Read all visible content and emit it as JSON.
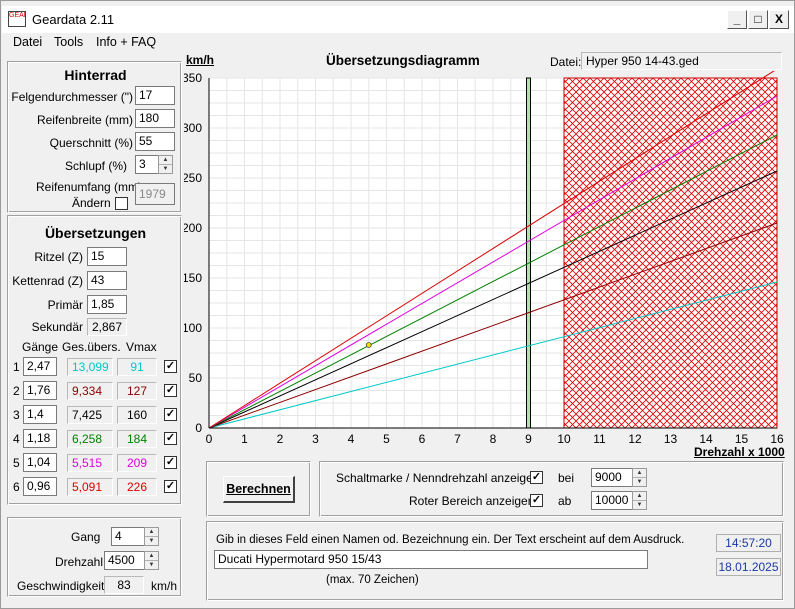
{
  "window": {
    "title": "Geardata 2.11",
    "icon_text": "GEAR",
    "buttons": {
      "minimize": "_",
      "maximize": "□",
      "close": "X"
    }
  },
  "menu": [
    "Datei",
    "Tools",
    "Info + FAQ"
  ],
  "hinterrad": {
    "title": "Hinterrad",
    "felgen_label": "Felgendurchmesser (\")",
    "felgen_value": "17",
    "breite_label": "Reifenbreite (mm)",
    "breite_value": "180",
    "querschnitt_label": "Querschnitt (%)",
    "querschnitt_value": "55",
    "schlupf_label": "Schlupf (%)",
    "schlupf_value": "3",
    "umfang_label": "Reifenumfang (mm)",
    "aendern_label": "Ändern",
    "umfang_value": "1979"
  },
  "uebersetzungen": {
    "title": "Übersetzungen",
    "ritzel_label": "Ritzel (Z)",
    "ritzel_value": "15",
    "kettenrad_label": "Kettenrad (Z)",
    "kettenrad_value": "43",
    "primaer_label": "Primär",
    "primaer_value": "1,85",
    "sekundaer_label": "Sekundär",
    "sekundaer_value": "2,867",
    "col_gaenge": "Gänge",
    "col_ges": "Ges.übers.",
    "col_vmax": "Vmax",
    "gears": [
      {
        "num": "1",
        "ratio": "2,47",
        "total": "13,099",
        "vmax": "91",
        "color": "#00c8c8"
      },
      {
        "num": "2",
        "ratio": "1,76",
        "total": "9,334",
        "vmax": "127",
        "color": "#8b0000"
      },
      {
        "num": "3",
        "ratio": "1,4",
        "total": "7,425",
        "vmax": "160",
        "color": "#000000"
      },
      {
        "num": "4",
        "ratio": "1,18",
        "total": "6,258",
        "vmax": "184",
        "color": "#008000"
      },
      {
        "num": "5",
        "ratio": "1,04",
        "total": "5,515",
        "vmax": "209",
        "color": "#e000e0"
      },
      {
        "num": "6",
        "ratio": "0,96",
        "total": "5,091",
        "vmax": "226",
        "color": "#dd0000"
      }
    ]
  },
  "bottom_left": {
    "gang_label": "Gang",
    "gang_value": "4",
    "drehzahl_label": "Drehzahl",
    "drehzahl_value": "4500",
    "geschw_label": "Geschwindigkeit:",
    "geschw_value": "83",
    "geschw_unit": "km/h"
  },
  "chart_header": {
    "ylabel": "km/h",
    "title": "Übersetzungsdiagramm",
    "datei_label": "Datei:",
    "datei_value": "Hyper 950 14-43.ged"
  },
  "controls": {
    "berechnen": "Berechnen",
    "schaltmarke_label": "Schaltmarke / Nenndrehzahl anzeigen",
    "bei_label": "bei",
    "schaltmarke_value": "9000",
    "roter_label": "Roter Bereich anzeigen",
    "ab_label": "ab",
    "roter_value": "10000",
    "hint": "Gib in dieses Feld einen Namen od. Bezeichnung ein. Der Text erscheint auf dem Ausdruck.",
    "name_value": "Ducati Hypermotard 950 15/43",
    "max_hint": "(max. 70 Zeichen)",
    "time": "14:57:20",
    "date": "18.01.2025"
  },
  "chart_data": {
    "type": "line",
    "title": "Übersetzungsdiagramm",
    "ylabel": "km/h",
    "xlabel": "Drehzahl x 1000",
    "xlim": [
      0,
      16
    ],
    "ylim": [
      0,
      350
    ],
    "x_ticks": [
      "0",
      "1",
      "2",
      "3",
      "4",
      "5",
      "6",
      "7",
      "8",
      "9",
      "10",
      "11",
      "12",
      "13",
      "14",
      "15",
      "16"
    ],
    "y_ticks": [
      "0",
      "50",
      "100",
      "150",
      "200",
      "250",
      "300",
      "350"
    ],
    "series": [
      {
        "color": "#00c8c8",
        "x": [
          0,
          16
        ],
        "y": [
          0,
          146
        ]
      },
      {
        "color": "#8b0000",
        "x": [
          0,
          16
        ],
        "y": [
          0,
          205
        ]
      },
      {
        "color": "#000000",
        "x": [
          0,
          16
        ],
        "y": [
          0,
          257
        ]
      },
      {
        "color": "#008000",
        "x": [
          0,
          16
        ],
        "y": [
          0,
          293
        ]
      },
      {
        "color": "#e000e0",
        "x": [
          0,
          16
        ],
        "y": [
          0,
          332
        ]
      },
      {
        "color": "#dd0000",
        "x": [
          0,
          16
        ],
        "y": [
          0,
          359
        ]
      }
    ],
    "shift_mark_rpm": 9,
    "red_zone_from": 10,
    "marker": {
      "x": 4.5,
      "y": 83
    },
    "grid": true
  }
}
